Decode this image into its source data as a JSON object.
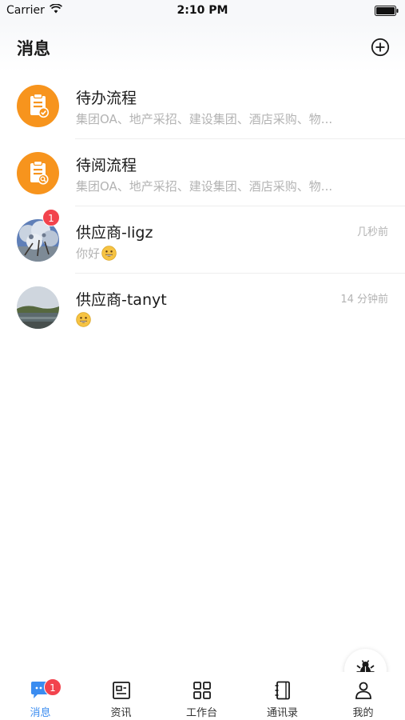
{
  "status_bar": {
    "carrier": "Carrier",
    "time": "2:10 PM"
  },
  "header": {
    "title": "消息"
  },
  "messages": [
    {
      "title": "待办流程",
      "subtitle": "集团OA、地产采招、建设集团、酒店采购、物...",
      "time": "",
      "icon": "clipboard-check-icon"
    },
    {
      "title": "待阅流程",
      "subtitle": "集团OA、地产采招、建设集团、酒店采购、物...",
      "time": "",
      "icon": "clipboard-search-icon"
    },
    {
      "title": "供应商-ligz",
      "subtitle": "你好",
      "time": "几秒前",
      "badge": "1",
      "avatar": "tree-photo"
    },
    {
      "title": "供应商-tanyt",
      "subtitle": "",
      "time": "14 分钟前",
      "avatar": "lake-photo"
    }
  ],
  "tabs": [
    {
      "label": "消息",
      "badge": "1",
      "icon": "chat-icon",
      "active": true
    },
    {
      "label": "资讯",
      "icon": "news-icon",
      "active": false
    },
    {
      "label": "工作台",
      "icon": "grid-icon",
      "active": false
    },
    {
      "label": "通讯录",
      "icon": "contacts-icon",
      "active": false
    },
    {
      "label": "我的",
      "icon": "person-icon",
      "active": false
    }
  ],
  "colors": {
    "accent": "#3a8cf0",
    "orange": "#f7941d",
    "badge": "#f2434d",
    "muted": "#b3b3b3"
  }
}
